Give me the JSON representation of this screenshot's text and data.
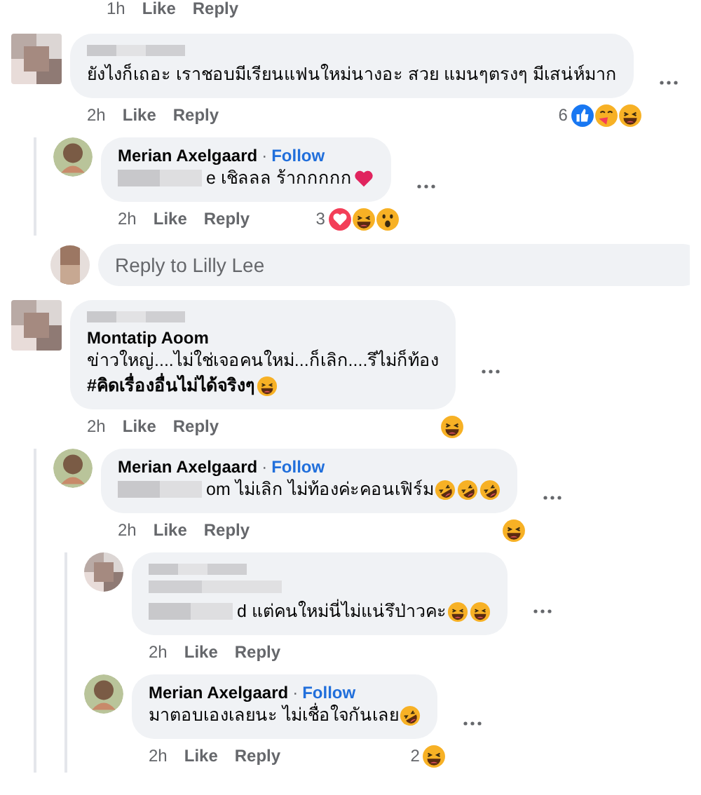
{
  "top_actions": {
    "time": "1h",
    "like": "Like",
    "reply": "Reply"
  },
  "threads": [
    {
      "name_blurred": true,
      "lines": [
        {
          "text": "ยังไงก็เถอะ เราชอบมีเรียนแฟนใหม่นางอะ สวย แมนๆตรงๆ มีเสน่ห์มาก",
          "bold": false
        }
      ],
      "time": "2h",
      "like": "Like",
      "reply": "Reply",
      "reaction_count": "6",
      "reactions": [
        {
          "kind": "like"
        },
        {
          "kind": "care"
        },
        {
          "kind": "haha"
        }
      ],
      "children": [
        {
          "name": "Merian Axelgaard",
          "separator": "·",
          "follow": "Follow",
          "blurred_prefix": true,
          "lines": [
            {
              "text": "e เชิลลล ร้ากกกกก ",
              "bold": false
            }
          ],
          "emojis": [
            {
              "kind": "heart"
            }
          ],
          "time": "2h",
          "like": "Like",
          "reply": "Reply",
          "reaction_count": "3",
          "reactions": [
            {
              "kind": "love"
            },
            {
              "kind": "haha"
            },
            {
              "kind": "wow"
            }
          ]
        }
      ],
      "reply_box": {
        "placeholder": "Reply to Lilly Lee"
      }
    },
    {
      "name_blurred": true,
      "name": "Montatip Aoom",
      "lines": [
        {
          "text": "ข่าวใหญ่....ไม่ใช่เจอคนใหม่...ก็เลิก....รึไม่ก็ท้อง",
          "bold": false
        },
        {
          "text": "#คิดเรื่องอื่นไม่ได้จริงๆ",
          "bold": true
        }
      ],
      "emojis": [
        {
          "kind": "laugh"
        }
      ],
      "time": "2h",
      "like": "Like",
      "reply": "Reply",
      "reactions": [
        {
          "kind": "haha"
        }
      ],
      "children": [
        {
          "name": "Merian Axelgaard",
          "separator": "·",
          "follow": "Follow",
          "blurred_prefix": true,
          "lines": [
            {
              "text": "om ไม่เลิก ไม่ท้องค่ะคอนเฟิร์ม ",
              "bold": false
            }
          ],
          "emojis": [
            {
              "kind": "rofl"
            },
            {
              "kind": "rofl"
            },
            {
              "kind": "rofl"
            }
          ],
          "time": "2h",
          "like": "Like",
          "reply": "Reply",
          "reactions": [
            {
              "kind": "haha"
            }
          ],
          "children": [
            {
              "name_blurred": true,
              "blurred_line": true,
              "blurred_prefix": true,
              "lines": [
                {
                  "text": "d แต่คนใหม่นี่ไม่แน่รึป่าวคะ",
                  "bold": false
                }
              ],
              "emojis": [
                {
                  "kind": "laugh"
                },
                {
                  "kind": "laugh"
                }
              ],
              "time": "2h",
              "like": "Like",
              "reply": "Reply"
            },
            {
              "name": "Merian Axelgaard",
              "separator": "·",
              "follow": "Follow",
              "lines": [
                {
                  "text": "มาตอบเองเลยนะ ไม่เชื่อใจกันเลย",
                  "bold": false
                }
              ],
              "emojis": [
                {
                  "kind": "rofl"
                }
              ],
              "time": "2h",
              "like": "Like",
              "reply": "Reply",
              "reaction_count": "2",
              "reactions": [
                {
                  "kind": "haha"
                }
              ]
            }
          ]
        }
      ]
    }
  ]
}
